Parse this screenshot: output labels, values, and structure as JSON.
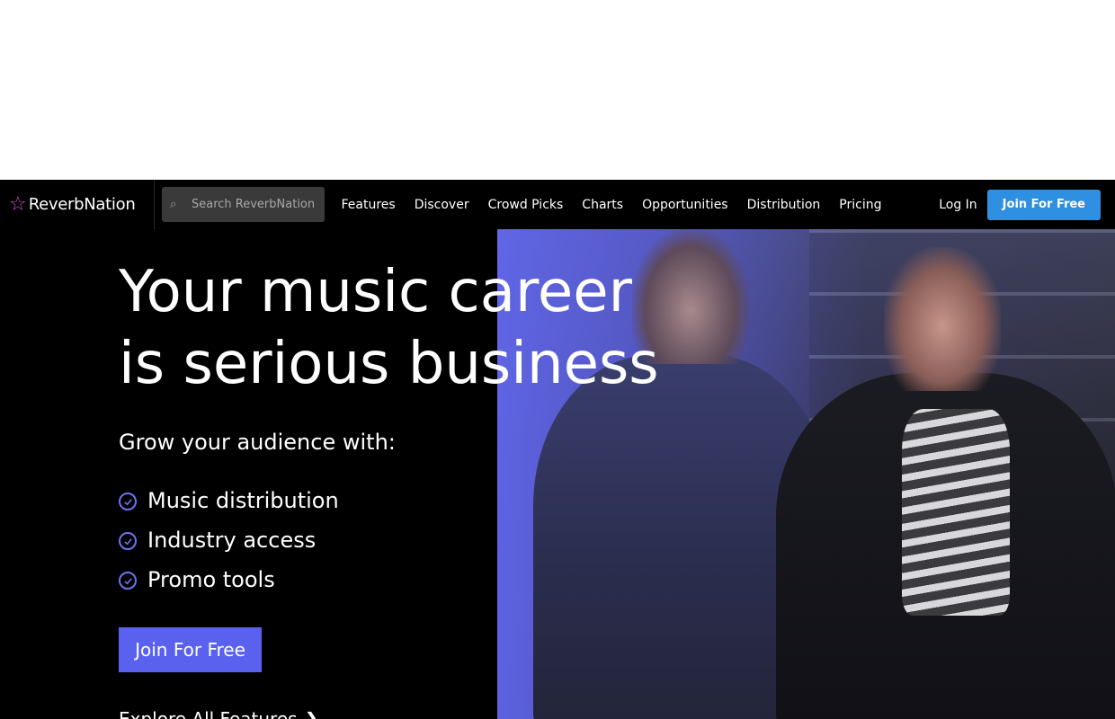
{
  "brand": {
    "name": "ReverbNation",
    "accent_color": "#d94ec9"
  },
  "search": {
    "placeholder": "Search ReverbNation"
  },
  "nav": {
    "items": [
      {
        "label": "Features"
      },
      {
        "label": "Discover"
      },
      {
        "label": "Crowd Picks"
      },
      {
        "label": "Charts"
      },
      {
        "label": "Opportunities"
      },
      {
        "label": "Distribution"
      },
      {
        "label": "Pricing"
      }
    ],
    "login_label": "Log In",
    "join_label": "Join For Free",
    "join_color": "#2f8fe0"
  },
  "hero": {
    "title_line1": "Your music career",
    "title_line2": "is serious business",
    "subtitle": "Grow your audience with:",
    "features": [
      {
        "label": "Music distribution",
        "icon": "check-circle-icon"
      },
      {
        "label": "Industry access",
        "icon": "check-circle-icon"
      },
      {
        "label": "Promo tools",
        "icon": "check-circle-icon"
      }
    ],
    "cta_label": "Join For Free",
    "cta_color": "#5a61ee",
    "explore_label": "Explore All Features"
  }
}
